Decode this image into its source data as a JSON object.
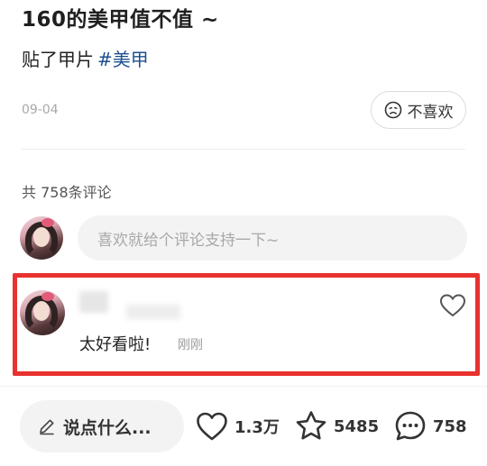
{
  "post": {
    "title": "160的美甲值不值 ~",
    "body": "贴了甲片",
    "tag": "#美甲",
    "date": "09-04",
    "dislike_label": "不喜欢"
  },
  "comments": {
    "count_label": "共 758条评论",
    "input_placeholder": "喜欢就给个评论支持一下~",
    "items": [
      {
        "text": "太好看啦!",
        "time": "刚刚"
      }
    ]
  },
  "bottom_bar": {
    "say_label": "说点什么...",
    "likes": "1.3万",
    "favorites": "5485",
    "comments": "758"
  }
}
